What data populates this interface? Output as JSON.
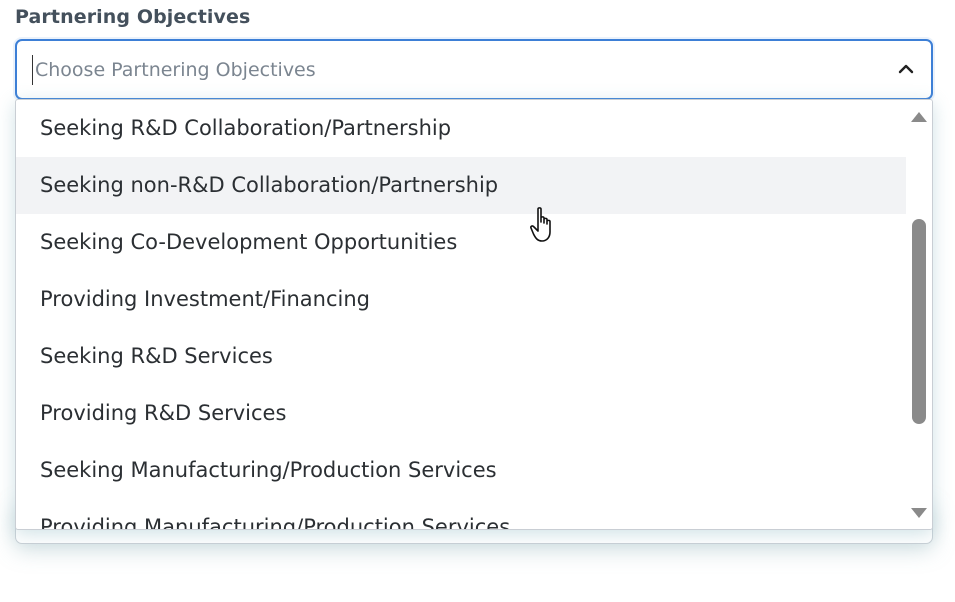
{
  "field": {
    "label": "Partnering Objectives",
    "placeholder": "Choose Partnering Objectives",
    "value": ""
  },
  "dropdown": {
    "options": [
      {
        "label": "Seeking R&D Collaboration/Partnership",
        "hovered": false
      },
      {
        "label": "Seeking non-R&D Collaboration/Partnership",
        "hovered": true
      },
      {
        "label": "Seeking Co-Development Opportunities",
        "hovered": false
      },
      {
        "label": "Providing Investment/Financing",
        "hovered": false
      },
      {
        "label": "Seeking R&D Services",
        "hovered": false
      },
      {
        "label": "Providing R&D Services",
        "hovered": false
      },
      {
        "label": "Seeking Manufacturing/Production Services",
        "hovered": false
      },
      {
        "label": "Providing Manufacturing/Production Services",
        "hovered": false
      }
    ]
  },
  "icons": {
    "toggle": "chevron-up-icon",
    "scroll_up": "scroll-up-arrow-icon",
    "scroll_down": "scroll-down-arrow-icon",
    "cursor": "hand-pointer-cursor-icon"
  },
  "colors": {
    "focus_border": "#3d7fd6",
    "hover_bg": "#f2f3f5",
    "scroll_thumb": "#8a8a8a",
    "label_text": "#44505c"
  }
}
